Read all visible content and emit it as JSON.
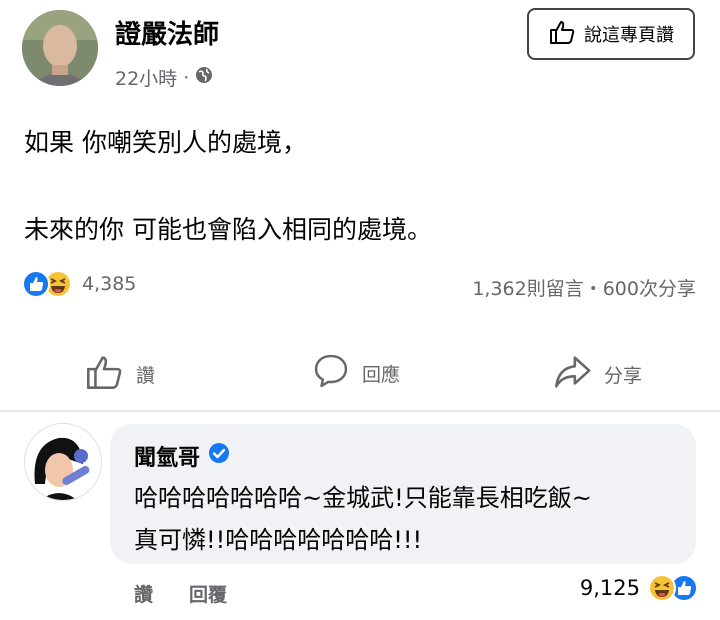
{
  "post": {
    "author": "證嚴法師",
    "time": "22小時",
    "separator": "·",
    "like_page_label": "說這專頁讚",
    "line1": "如果 你嘲笑別人的處境，",
    "line2": "未來的你 可能也會陷入相同的處境。",
    "reaction_count": "4,385",
    "stats": "1,362則留言・600次分享",
    "actions": {
      "like": "讚",
      "comment": "回應",
      "share": "分享"
    }
  },
  "comment": {
    "author": "聞氫哥",
    "line1": "哈哈哈哈哈哈哈~金城武!只能靠長相吃飯~",
    "line2": "真可憐!!哈哈哈哈哈哈哈!!!",
    "like_label": "讚",
    "reply_label": "回覆",
    "reaction_count": "9,125"
  },
  "colors": {
    "like_blue": "#1877f2",
    "haha_yellow": "#f7c238",
    "text_gray": "#65676b",
    "bubble_bg": "#f0f2f5"
  },
  "icons": [
    "globe-icon",
    "thumbs-up-icon",
    "comment-icon",
    "share-icon",
    "verified-icon",
    "like-reaction-icon",
    "haha-reaction-icon"
  ]
}
